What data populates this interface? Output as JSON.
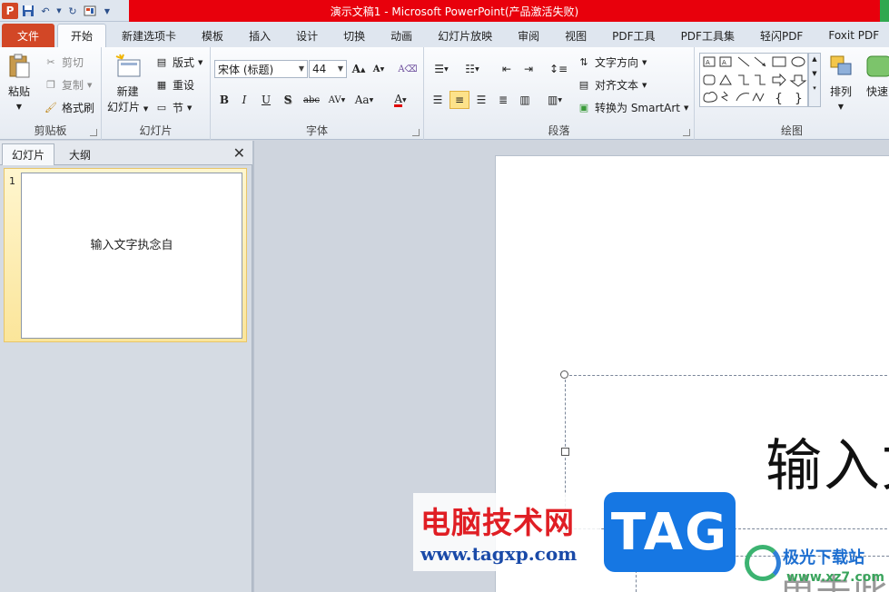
{
  "window": {
    "title": "演示文稿1 - Microsoft PowerPoint(产品激活失败)",
    "app_icon_letter": "P"
  },
  "quick_access": [
    "save-icon",
    "undo-icon",
    "redo-icon",
    "layout-icon",
    "customize-icon"
  ],
  "tabs": [
    "文件",
    "开始",
    "新建选项卡",
    "模板",
    "插入",
    "设计",
    "切换",
    "动画",
    "幻灯片放映",
    "审阅",
    "视图",
    "PDF工具",
    "PDF工具集",
    "轻闪PDF",
    "Foxit PDF"
  ],
  "active_tab": "开始",
  "ribbon": {
    "clipboard": {
      "label": "剪贴板",
      "paste": "粘贴",
      "cut": "剪切",
      "copy": "复制",
      "format_painter": "格式刷"
    },
    "slides": {
      "label": "幻灯片",
      "new_slide_line1": "新建",
      "new_slide_line2": "幻灯片",
      "layout": "版式",
      "reset": "重设",
      "section": "节"
    },
    "font": {
      "label": "字体",
      "font_name": "宋体 (标题)",
      "font_size": "44",
      "grow": "A",
      "shrink": "A",
      "clear": "A",
      "bold": "B",
      "italic": "I",
      "underline": "U",
      "shadow": "S",
      "strike": "abc",
      "spacing": "AV",
      "case": "Aa",
      "color": "A"
    },
    "paragraph": {
      "label": "段落",
      "text_direction": "文字方向",
      "align_text": "对齐文本",
      "smartart": "转换为 SmartArt"
    },
    "drawing": {
      "label": "绘图",
      "arrange": "排列",
      "quick_styles": "快速"
    }
  },
  "left_panel": {
    "tabs": [
      "幻灯片",
      "大纲"
    ],
    "close": "✕",
    "slides": [
      {
        "number": "1",
        "text": "输入文字执念自"
      }
    ]
  },
  "slide": {
    "title_text": "输入文",
    "subtitle_text": "单击此"
  },
  "watermarks": {
    "site_title": "电脑技术网",
    "site_url": "www.tagxp.com",
    "tag": "TAG",
    "brand_title": "极光下载站",
    "brand_url": "www.xz7.com"
  },
  "colors": {
    "file_tab": "#d24726",
    "title_bar": "#e8000c",
    "selected_thumb": "#fbe59a",
    "tag_blue": "#1677e3"
  }
}
